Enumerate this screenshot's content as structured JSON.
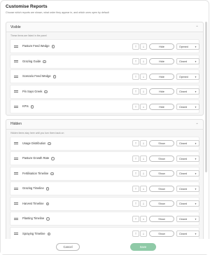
{
  "modal": {
    "title": "Customise Reports",
    "subtitle": "Choose which reports are shown, what order they appear in, and which ones open by default"
  },
  "visible": {
    "title": "Visible",
    "note": "These items are listed in the panel",
    "items": [
      {
        "label": "Pasture Feed Wedge",
        "toggle": "Hide",
        "state": "Opened"
      },
      {
        "label": "Grazing Guide",
        "toggle": "Hide",
        "state": "Closed"
      },
      {
        "label": "Scenario Feed Wedge",
        "toggle": "Hide",
        "state": "Opened"
      },
      {
        "label": "Pin Says Greek",
        "toggle": "Hide",
        "state": "Closed"
      },
      {
        "label": "KPIs",
        "toggle": "Hide",
        "state": "Closed"
      }
    ]
  },
  "hidden": {
    "title": "Hidden",
    "note": "Hidden items stay here until you turn them back on",
    "items": [
      {
        "label": "Usage Distribution",
        "toggle": "Show",
        "state": "Closed"
      },
      {
        "label": "Pasture Growth Rate",
        "toggle": "Show",
        "state": "Closed"
      },
      {
        "label": "Fertilisation Timeline",
        "toggle": "Show",
        "state": "Closed"
      },
      {
        "label": "Grazing Timeline",
        "toggle": "Show",
        "state": "Closed"
      },
      {
        "label": "Harvest Timeline",
        "toggle": "Show",
        "state": "Closed"
      },
      {
        "label": "Planting Timeline",
        "toggle": "Show",
        "state": "Closed"
      },
      {
        "label": "Spraying Timeline",
        "toggle": "Show",
        "state": "Closed"
      }
    ]
  },
  "footer": {
    "cancel": "Cancel",
    "save": "Save"
  },
  "colors": {
    "save_button": "#8fcaa7"
  },
  "icons": {
    "up": "arrow-up-icon",
    "down": "arrow-down-icon",
    "drag": "drag-handle-icon",
    "info": "info-icon",
    "collapse": "chevron-up-icon",
    "caret": "chevron-down-icon"
  }
}
